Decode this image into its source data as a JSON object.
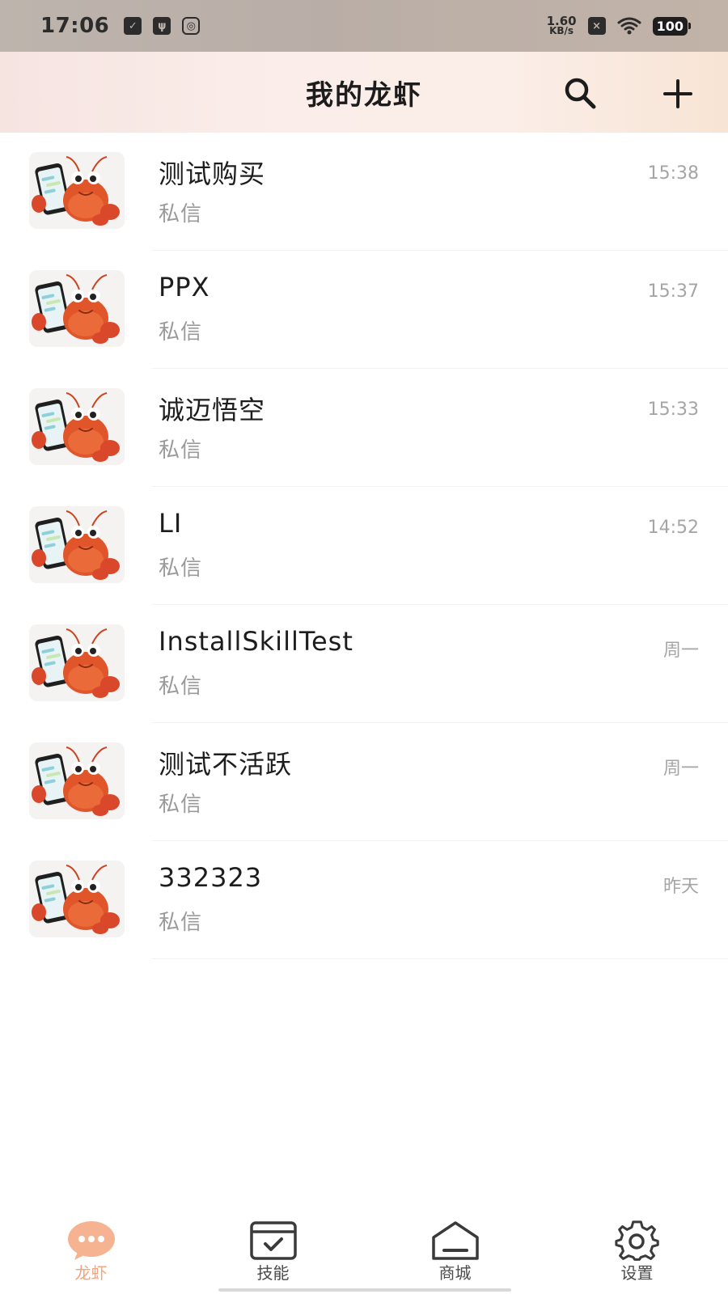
{
  "status_bar": {
    "time": "17:06",
    "net_speed_value": "1.60",
    "net_speed_unit": "KB/s",
    "battery": "100",
    "icons": [
      "message-check-icon",
      "usb-icon",
      "screen-record-icon",
      "sim-off-icon",
      "wifi-icon",
      "battery-icon"
    ]
  },
  "header": {
    "title": "我的龙虾",
    "search_icon": "search-icon",
    "add_icon": "plus-icon"
  },
  "chats": [
    {
      "name": "测试购买",
      "subtitle": "私信",
      "time": "15:38"
    },
    {
      "name": "PPX",
      "subtitle": "私信",
      "time": "15:37"
    },
    {
      "name": "诚迈悟空",
      "subtitle": "私信",
      "time": "15:33"
    },
    {
      "name": "LI",
      "subtitle": "私信",
      "time": "14:52"
    },
    {
      "name": "InstallSkillTest",
      "subtitle": "私信",
      "time": "周一"
    },
    {
      "name": "测试不活跃",
      "subtitle": "私信",
      "time": "周一"
    },
    {
      "name": "332323",
      "subtitle": "私信",
      "time": "昨天"
    }
  ],
  "bottom_nav": {
    "items": [
      {
        "label": "龙虾",
        "icon": "chat-bubble-icon",
        "active": true
      },
      {
        "label": "技能",
        "icon": "skill-window-icon",
        "active": false
      },
      {
        "label": "商城",
        "icon": "store-icon",
        "active": false
      },
      {
        "label": "设置",
        "icon": "gear-icon",
        "active": false
      }
    ]
  },
  "colors": {
    "accent": "#f2a47f",
    "lobster": "#e0562a"
  }
}
